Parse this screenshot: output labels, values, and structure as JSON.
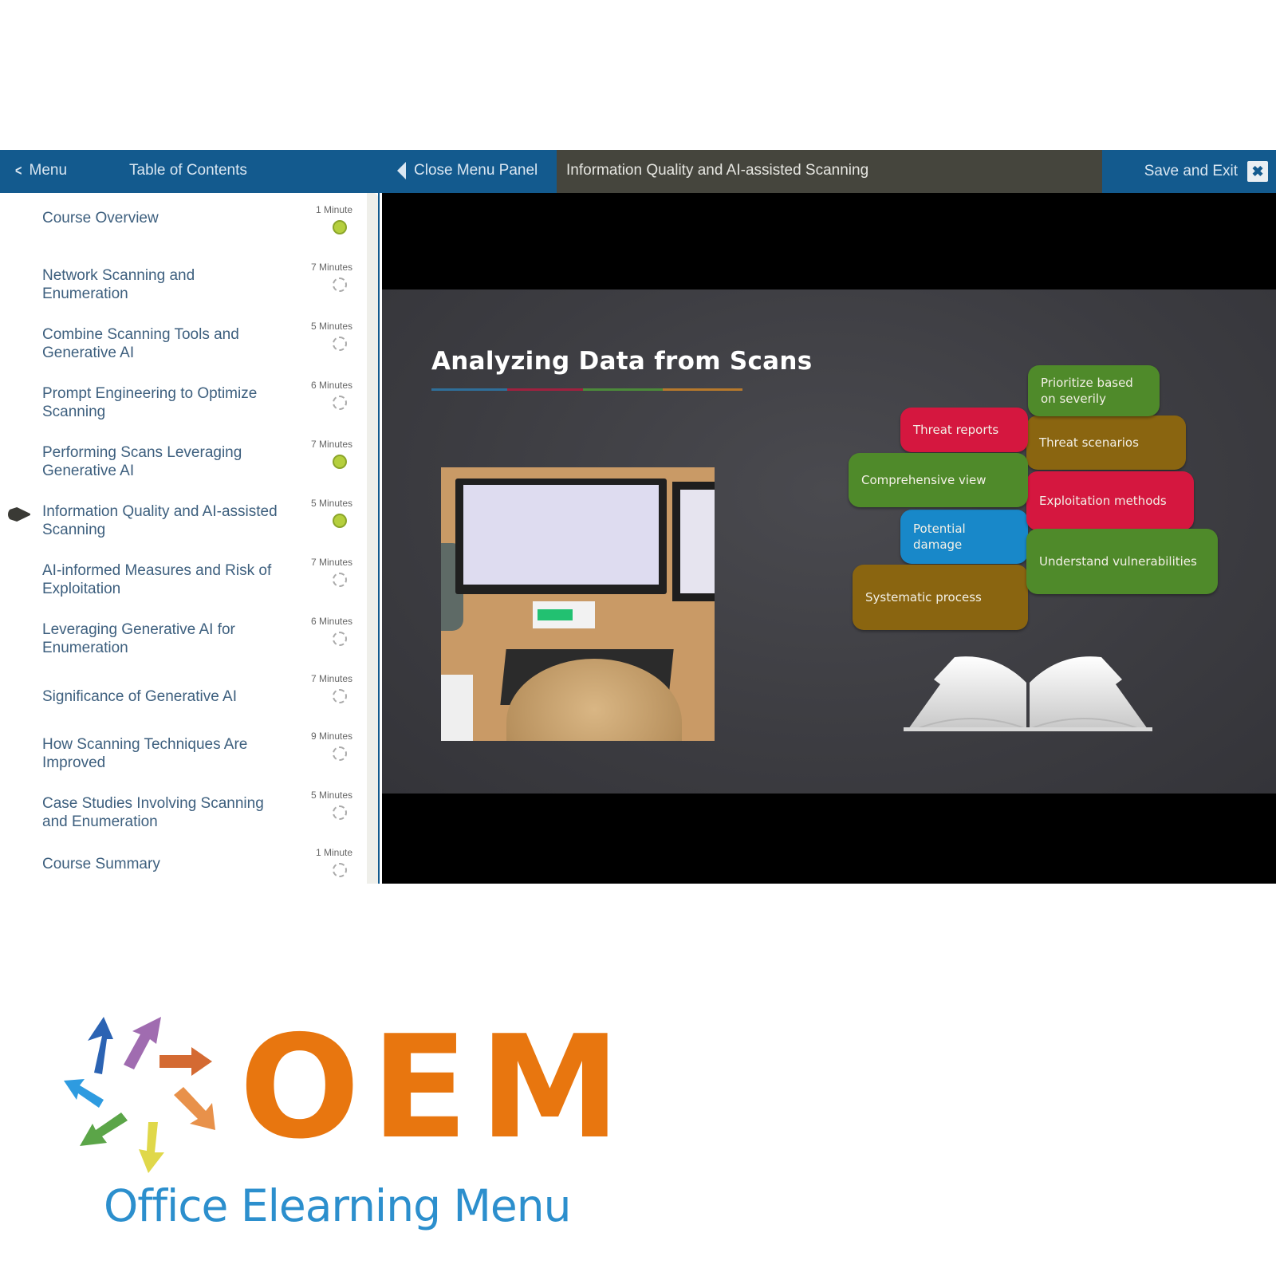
{
  "topbar": {
    "menu_label": "Menu",
    "toc_label": "Table of Contents",
    "close_panel_label": "Close Menu Panel",
    "lesson_title": "Information Quality and AI-assisted Scanning",
    "save_exit_label": "Save and Exit",
    "close_symbol": "✖"
  },
  "sidebar": {
    "items": [
      {
        "title": "Course Overview",
        "duration": "1 Minute",
        "status": "complete"
      },
      {
        "title": "Network Scanning and Enumeration",
        "duration": "7 Minutes",
        "status": "incomplete"
      },
      {
        "title": "Combine Scanning Tools and Generative AI",
        "duration": "5 Minutes",
        "status": "incomplete"
      },
      {
        "title": "Prompt Engineering to Optimize Scanning",
        "duration": "6 Minutes",
        "status": "incomplete"
      },
      {
        "title": "Performing Scans Leveraging Generative AI",
        "duration": "7 Minutes",
        "status": "complete"
      },
      {
        "title": "Information Quality and AI-assisted Scanning",
        "duration": "5 Minutes",
        "status": "complete",
        "current": true
      },
      {
        "title": "AI-informed Measures and Risk of Exploitation",
        "duration": "7 Minutes",
        "status": "incomplete"
      },
      {
        "title": "Leveraging Generative AI for Enumeration",
        "duration": "6 Minutes",
        "status": "incomplete"
      },
      {
        "title": "Significance of Generative AI",
        "duration": "7 Minutes",
        "status": "incomplete"
      },
      {
        "title": "How Scanning Techniques Are Improved",
        "duration": "9 Minutes",
        "status": "incomplete"
      },
      {
        "title": "Case Studies Involving Scanning and Enumeration",
        "duration": "5 Minutes",
        "status": "incomplete"
      },
      {
        "title": "Course Summary",
        "duration": "1 Minute",
        "status": "incomplete"
      }
    ]
  },
  "slide": {
    "title": "Analyzing Data from Scans",
    "underline_colors": [
      "#2f6f9a",
      "#a0213f",
      "#4c8a3a",
      "#b7792c"
    ],
    "bubbles": [
      {
        "text": "Prioritize based on severily",
        "color": "green"
      },
      {
        "text": "Threat reports",
        "color": "red"
      },
      {
        "text": "Threat scenarios",
        "color": "brown"
      },
      {
        "text": "Comprehensive view",
        "color": "green"
      },
      {
        "text": "Exploitation methods",
        "color": "red"
      },
      {
        "text": "Potential damage",
        "color": "blue"
      },
      {
        "text": "Understand vulnerabilities",
        "color": "green"
      },
      {
        "text": "Systematic process",
        "color": "brown"
      }
    ]
  },
  "colors": {
    "brand_blue": "#135a8e",
    "title_bar": "#45453d",
    "complete_green": "#b5cf3d",
    "logo_orange": "#e8760f",
    "logo_blue": "#2c8fcd"
  },
  "logo": {
    "wordmark": "OEM",
    "tagline": "Office Elearning Menu"
  }
}
